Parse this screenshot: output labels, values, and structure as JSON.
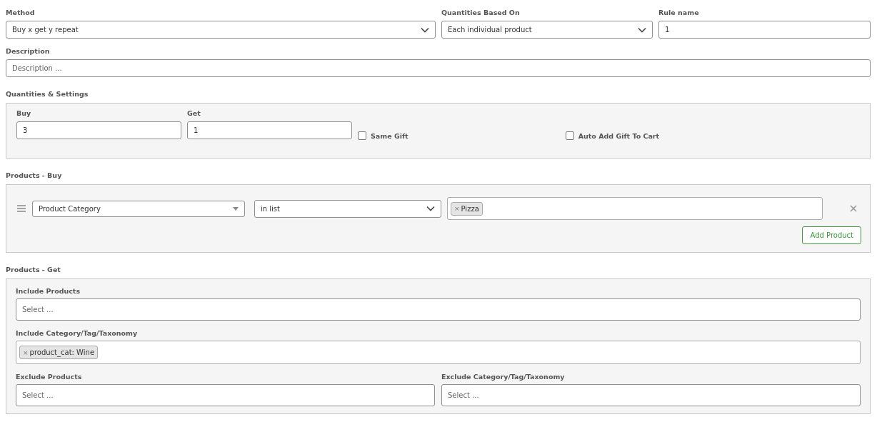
{
  "method": {
    "label": "Method",
    "value": "Buy x get y repeat"
  },
  "quantities_based_on": {
    "label": "Quantities Based On",
    "value": "Each individual product"
  },
  "rule_name": {
    "label": "Rule name",
    "value": "1"
  },
  "description": {
    "label": "Description",
    "placeholder": "Description ..."
  },
  "quantities_settings": {
    "title": "Quantities & Settings",
    "buy": {
      "label": "Buy",
      "value": "3"
    },
    "get": {
      "label": "Get",
      "value": "1"
    },
    "checkboxes": [
      {
        "label": "Same Gift",
        "checked": false
      },
      {
        "label": "Auto Add Gift To Cart",
        "checked": false
      }
    ]
  },
  "products_buy": {
    "title": "Products - Buy",
    "rows": [
      {
        "type": "Product Category",
        "condition": "in list",
        "tags": [
          {
            "remove": "×",
            "label": "Pizza"
          }
        ]
      }
    ],
    "add_button": "Add Product"
  },
  "products_get": {
    "title": "Products - Get",
    "include_products": {
      "label": "Include Products",
      "placeholder": "Select ..."
    },
    "include_taxonomy": {
      "label": "Include Category/Tag/Taxonomy",
      "tags": [
        {
          "remove": "×",
          "label": "product_cat: Wine"
        }
      ]
    },
    "exclude_products": {
      "label": "Exclude Products",
      "placeholder": "Select ..."
    },
    "exclude_taxonomy": {
      "label": "Exclude Category/Tag/Taxonomy",
      "placeholder": "Select ..."
    }
  }
}
